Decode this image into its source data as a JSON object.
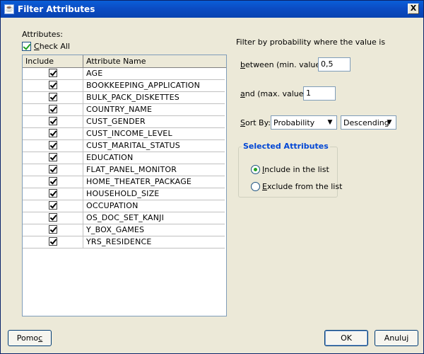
{
  "window": {
    "title": "Filter Attributes",
    "close_label": "X"
  },
  "attributes": {
    "label": "Attributes:",
    "check_all_label": "Check All",
    "check_all_checked": true,
    "columns": [
      "Include",
      "Attribute Name"
    ],
    "rows": [
      {
        "include": true,
        "name": "AGE"
      },
      {
        "include": true,
        "name": "BOOKKEEPING_APPLICATION"
      },
      {
        "include": true,
        "name": "BULK_PACK_DISKETTES"
      },
      {
        "include": true,
        "name": "COUNTRY_NAME"
      },
      {
        "include": true,
        "name": "CUST_GENDER"
      },
      {
        "include": true,
        "name": "CUST_INCOME_LEVEL"
      },
      {
        "include": true,
        "name": "CUST_MARITAL_STATUS"
      },
      {
        "include": true,
        "name": "EDUCATION"
      },
      {
        "include": true,
        "name": "FLAT_PANEL_MONITOR"
      },
      {
        "include": true,
        "name": "HOME_THEATER_PACKAGE"
      },
      {
        "include": true,
        "name": "HOUSEHOLD_SIZE"
      },
      {
        "include": true,
        "name": "OCCUPATION"
      },
      {
        "include": true,
        "name": "OS_DOC_SET_KANJI"
      },
      {
        "include": true,
        "name": "Y_BOX_GAMES"
      },
      {
        "include": true,
        "name": "YRS_RESIDENCE"
      }
    ]
  },
  "filter": {
    "heading": "Filter by probability where the value is",
    "between_label": "between (min. value):",
    "between_value": "0,5",
    "and_label": "and (max. value):",
    "and_value": "1"
  },
  "sort": {
    "label": "Sort By:",
    "by_value": "Probability",
    "order_value": "Descending"
  },
  "selected_attributes": {
    "title": "Selected Attributes",
    "include_label": "Include in the list",
    "exclude_label": "Exclude from the list",
    "selected": "include"
  },
  "buttons": {
    "help": "Pomoc",
    "ok": "OK",
    "cancel": "Anuluj"
  },
  "colors": {
    "titlebar": "#0b4cc4",
    "group_title": "#0046d5",
    "check_green": "#21a121"
  }
}
